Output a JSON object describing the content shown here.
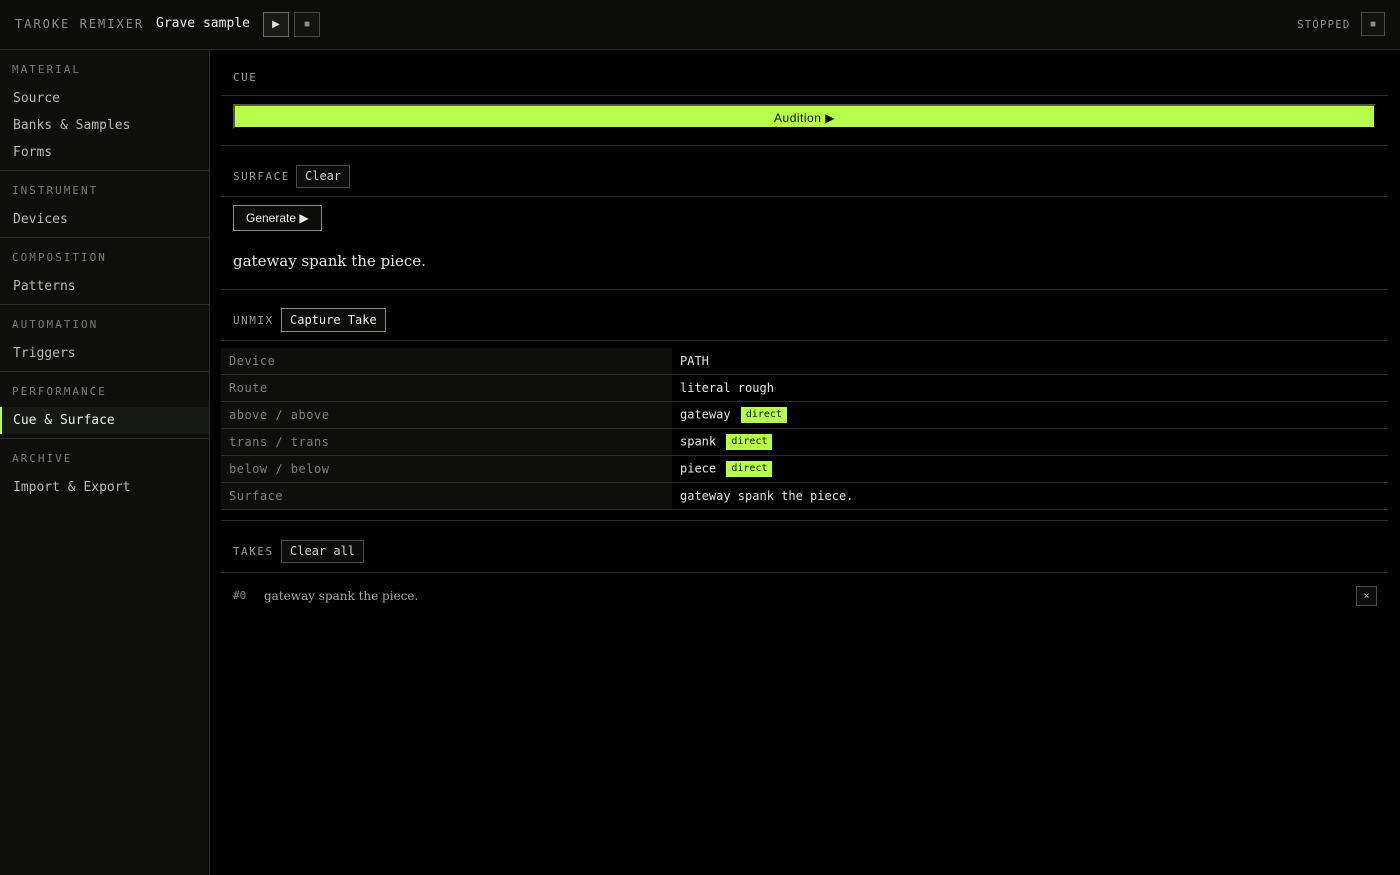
{
  "header": {
    "app_title": "TAROKE REMIXER",
    "doc_title": "Grave sample",
    "play_label": "▶",
    "stop_label": "■",
    "status": "STOPPED",
    "status_button_label": "■",
    "accent_color": "#b7ff4a",
    "progress_color": "#5ec8d8"
  },
  "sidebar": {
    "sections": [
      {
        "title": "MATERIAL",
        "items": [
          "Source",
          "Banks & Samples",
          "Forms"
        ]
      },
      {
        "title": "INSTRUMENT",
        "items": [
          "Devices"
        ]
      },
      {
        "title": "COMPOSITION",
        "items": [
          "Patterns"
        ]
      },
      {
        "title": "AUTOMATION",
        "items": [
          "Triggers"
        ]
      },
      {
        "title": "PERFORMANCE",
        "items": [
          "Cue & Surface"
        ]
      },
      {
        "title": "ARCHIVE",
        "items": [
          "Import & Export"
        ]
      }
    ],
    "active_item": "Cue & Surface"
  },
  "cue": {
    "label": "CUE",
    "audition_label": "Audition ▶"
  },
  "surface": {
    "label": "SURFACE",
    "clear_label": "Clear",
    "generate_label": "Generate ▶",
    "text": "gateway spank the piece."
  },
  "unmix": {
    "label": "UNMIX",
    "capture_label": "Capture Take",
    "header": {
      "key": "Device",
      "value": "PATH"
    },
    "rows": [
      {
        "key": "Route",
        "value": "literal rough",
        "badge": ""
      },
      {
        "key": "above / above",
        "value": "gateway",
        "badge": "direct"
      },
      {
        "key": "trans / trans",
        "value": "spank",
        "badge": "direct"
      },
      {
        "key": "below / below",
        "value": "piece",
        "badge": "direct"
      },
      {
        "key": "Surface",
        "value": "gateway spank the piece.",
        "badge": ""
      }
    ]
  },
  "takes": {
    "label": "TAKES",
    "clear_all_label": "Clear all",
    "items": [
      {
        "id": "#0",
        "text": "gateway spank the piece.",
        "remove_label": "×"
      }
    ]
  }
}
